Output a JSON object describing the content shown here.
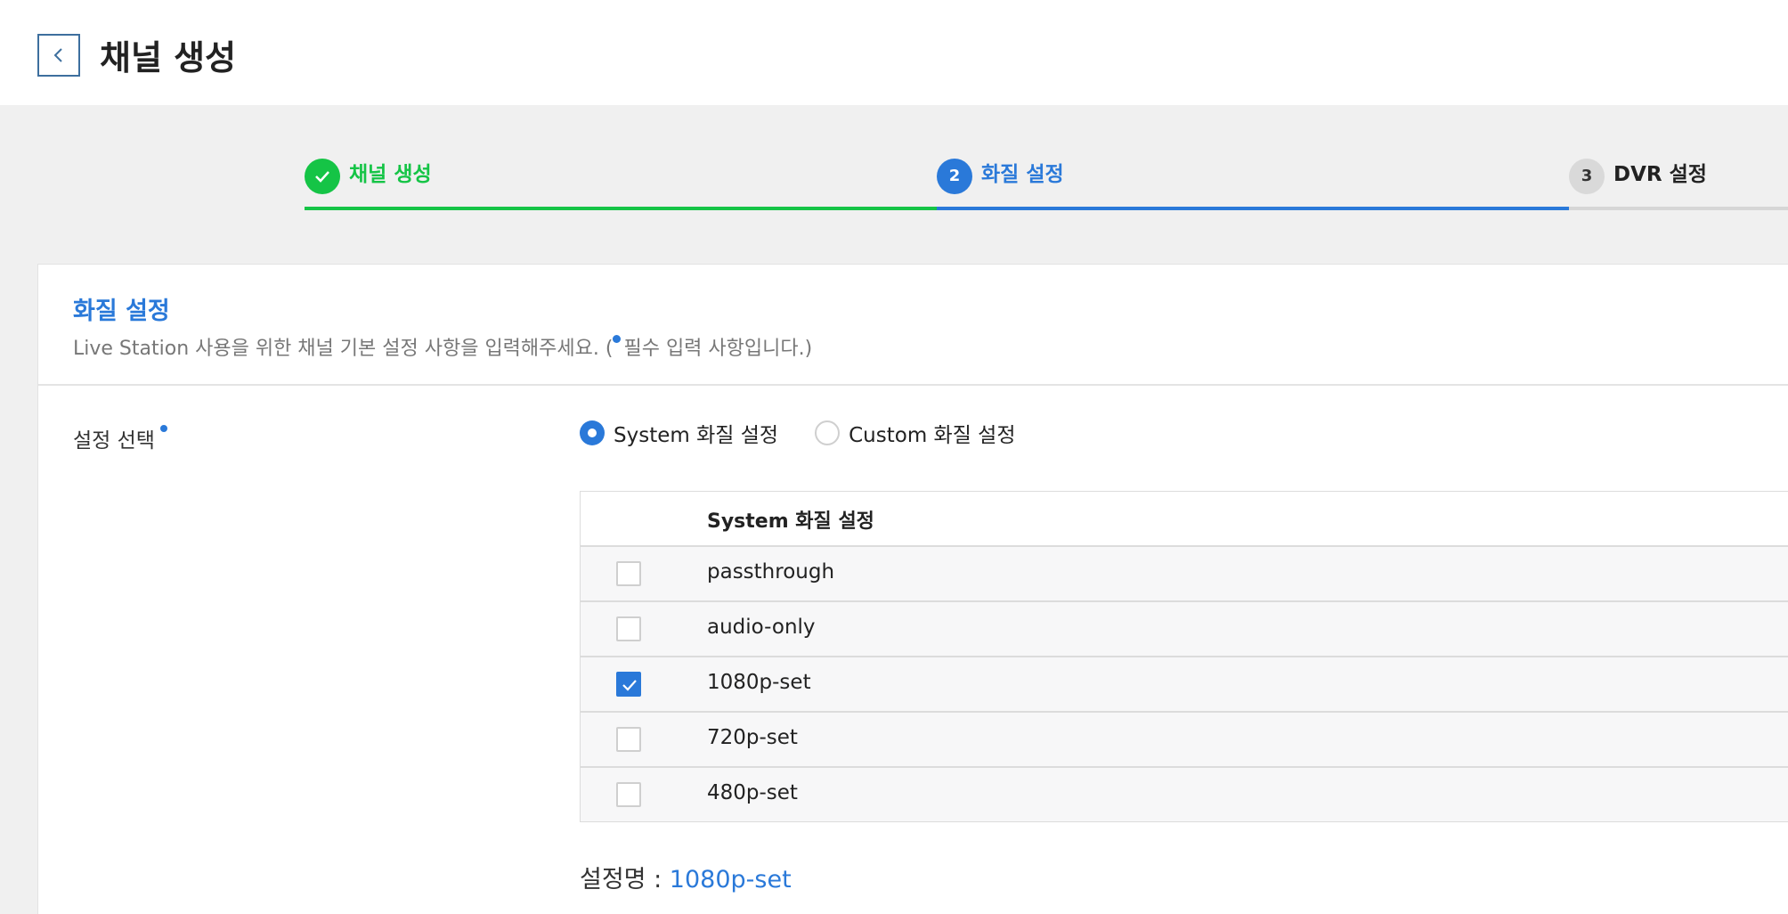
{
  "header": {
    "page_title": "채널 생성",
    "back_label": "back"
  },
  "steps": [
    {
      "number": "1",
      "label": "채널 생성",
      "state": "done",
      "color": "#15c446"
    },
    {
      "number": "2",
      "label": "화질 설정",
      "state": "active",
      "color": "#2a79d9"
    },
    {
      "number": "3",
      "label": "DVR 설정",
      "state": "pending",
      "color": "#d9d9d9"
    }
  ],
  "section": {
    "title": "화질 설정",
    "desc_before": "Live Station 사용을 위한 채널 기본 설정 사항을 입력해주세요. (",
    "desc_after": "필수 입력 사항입니다.)"
  },
  "settings": {
    "label": "설정 선택",
    "radio_options": [
      {
        "label": "System 화질 설정",
        "selected": true
      },
      {
        "label": "Custom 화질 설정",
        "selected": false
      }
    ],
    "table_header": "System 화질 설정",
    "rows": [
      {
        "name": "passthrough",
        "checked": false
      },
      {
        "name": "audio-only",
        "checked": false
      },
      {
        "name": "1080p-set",
        "checked": true
      },
      {
        "name": "720p-set",
        "checked": false
      },
      {
        "name": "480p-set",
        "checked": false
      }
    ],
    "summary_label": "설정명 : ",
    "summary_value": "1080p-set"
  },
  "colors": {
    "accent": "#2a79d9",
    "success": "#15c446",
    "background": "#f0f0f0"
  },
  "icons": {
    "back": "chevron-left-icon",
    "step_done": "check-icon",
    "checkbox_checked": "check-icon"
  }
}
